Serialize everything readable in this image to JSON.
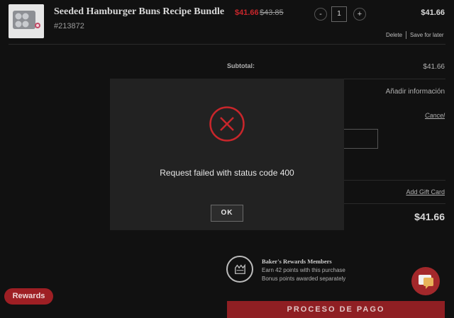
{
  "cart_item": {
    "title": "Seeded Hamburger Buns Recipe Bundle",
    "sku": "#213872",
    "sale_price": "$41.66",
    "original_price": "$43.85",
    "qty_minus": "-",
    "quantity": "1",
    "qty_plus": "+",
    "line_total": "$41.66",
    "delete_label": "Delete",
    "save_later_label": "Save for later"
  },
  "summary": {
    "subtotal_label": "Subtotal:",
    "subtotal_value": "$41.66",
    "add_info_label": "Añadir información",
    "cancel_label": "Cancel",
    "add_gift_card_label": "Add Gift Card",
    "total_value": "$41.66"
  },
  "rewards_block": {
    "title": "Baker's Rewards Members",
    "earn_text": "Earn 42 points with this purchase",
    "bonus_text": "Bonus points awarded separately"
  },
  "checkout_label": "PROCESO DE PAGO",
  "rewards_pill_label": "Rewards",
  "modal": {
    "icon": "error-x-circle-icon",
    "message": "Request failed with status code 400",
    "ok_label": "OK"
  },
  "colors": {
    "background": "#111111",
    "modal": "#222222",
    "accent_red": "#c8262b"
  }
}
